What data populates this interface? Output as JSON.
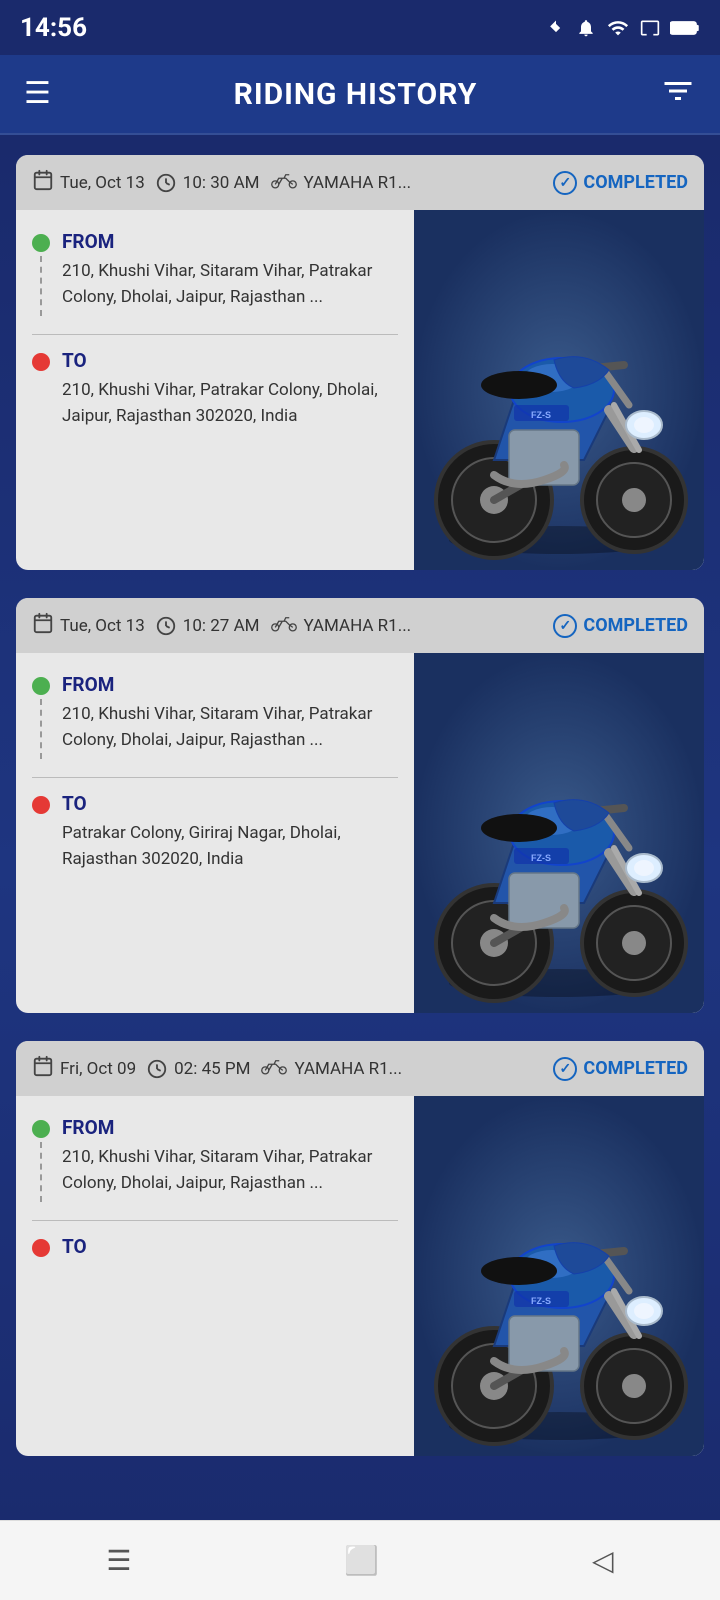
{
  "statusBar": {
    "time": "14:56",
    "icons": [
      "bluetooth",
      "bell",
      "wifi",
      "screen",
      "battery"
    ]
  },
  "header": {
    "title": "RIDING HISTORY",
    "menu_label": "≡",
    "filter_label": "⛉"
  },
  "rides": [
    {
      "id": "ride-1",
      "date": "Tue, Oct 13",
      "time": "10: 30 AM",
      "vehicle": "YAMAHA R1...",
      "status": "COMPLETED",
      "from_label": "FROM",
      "from_address": "210, Khushi Vihar, Sitaram Vihar, Patrakar Colony, Dholai, Jaipur, Rajasthan ...",
      "to_label": "TO",
      "to_address": "210, Khushi Vihar, Patrakar Colony, Dholai, Jaipur, Rajasthan 302020, India"
    },
    {
      "id": "ride-2",
      "date": "Tue, Oct 13",
      "time": "10: 27 AM",
      "vehicle": "YAMAHA R1...",
      "status": "COMPLETED",
      "from_label": "FROM",
      "from_address": "210, Khushi Vihar, Sitaram Vihar, Patrakar Colony, Dholai, Jaipur, Rajasthan ...",
      "to_label": "TO",
      "to_address": "Patrakar Colony, Giriraj Nagar, Dholai, Rajasthan 302020, India"
    },
    {
      "id": "ride-3",
      "date": "Fri, Oct 09",
      "time": "02: 45 PM",
      "vehicle": "YAMAHA R1...",
      "status": "COMPLETED",
      "from_label": "FROM",
      "from_address": "210, Khushi Vihar, Sitaram Vihar, Patrakar Colony, Dholai, Jaipur, Rajasthan ...",
      "to_label": "TO",
      "to_address": ""
    }
  ],
  "navbar": {
    "menu_icon": "☰",
    "home_icon": "⬜",
    "back_icon": "◁"
  }
}
